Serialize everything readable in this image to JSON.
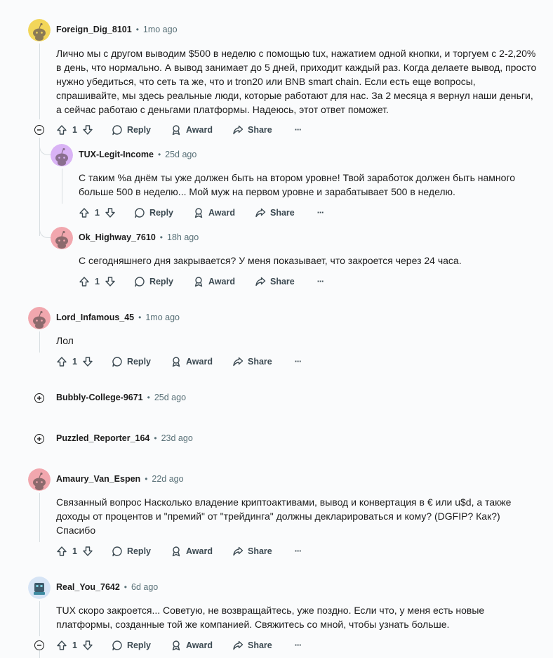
{
  "comments": [
    {
      "author": "Foreign_Dig_8101",
      "sep": "•",
      "time": "1mo ago",
      "body": "Лично мы с другом выводим $500 в неделю с помощью tux, нажатием одной кнопки, и торгуем с 2-2,20% в день, что нормально. А вывод занимает до 5 дней, приходит каждый раз. Когда делаете вывод, просто нужно убедиться, что сеть та же, что и tron20 или BNB smart chain. Если есть еще вопросы, спрашивайте, мы здесь реальные люди, которые работают для нас. За 2 месяца я вернул наши деньги, а сейчас работаю с деньгами платформы. Надеюсь, этот ответ поможет.",
      "votes": "1",
      "reply": "Reply",
      "award": "Award",
      "share": "Share",
      "more": "···",
      "avatar_color": "#f2d65a"
    },
    {
      "author": "TUX-Legit-Income",
      "sep": "•",
      "time": "25d ago",
      "body": "С таким %а днём ты уже должен быть на втором уровне! Твой заработок должен быть намного больше 500 в неделю... Мой муж на первом уровне и зарабатывает 500 в неделю.",
      "votes": "1",
      "reply": "Reply",
      "award": "Award",
      "share": "Share",
      "more": "···",
      "avatar_color": "#d9b3f5"
    },
    {
      "author": "Ok_Highway_7610",
      "sep": "•",
      "time": "18h ago",
      "body": "С сегодняшнего дня закрывается? У меня показывает, что закроется через 24 часа.",
      "votes": "1",
      "reply": "Reply",
      "award": "Award",
      "share": "Share",
      "more": "···",
      "avatar_color": "#f1a7ae"
    },
    {
      "author": "Lord_Infamous_45",
      "sep": "•",
      "time": "1mo ago",
      "body": "Лол",
      "votes": "1",
      "reply": "Reply",
      "award": "Award",
      "share": "Share",
      "more": "···",
      "avatar_color": "#f1a7ae"
    },
    {
      "author": "Bubbly-College-9671",
      "sep": "•",
      "time": "25d ago"
    },
    {
      "author": "Puzzled_Reporter_164",
      "sep": "•",
      "time": "23d ago"
    },
    {
      "author": "Amaury_Van_Espen",
      "sep": "•",
      "time": "22d ago",
      "body": "Связанный вопрос Насколько владение криптоактивами, вывод и конвертация в € или u$d, а также доходы от процентов и \"премий\" от \"трейдинга\" должны декларироваться и кому? (DGFIP? Как?) Спасибо",
      "votes": "1",
      "reply": "Reply",
      "award": "Award",
      "share": "Share",
      "more": "···",
      "avatar_color": "#f1a7ae"
    },
    {
      "author": "Real_You_7642",
      "sep": "•",
      "time": "6d ago",
      "body": "TUX скоро закроется... Советую, не возвращайтесь, уже поздно. Если что, у меня есть новые платформы, созданные той же компанией. Свяжитесь со мной, чтобы узнать больше.",
      "votes": "1",
      "reply": "Reply",
      "award": "Award",
      "share": "Share",
      "more": "···",
      "avatar_color": "#d6e4f5"
    }
  ]
}
